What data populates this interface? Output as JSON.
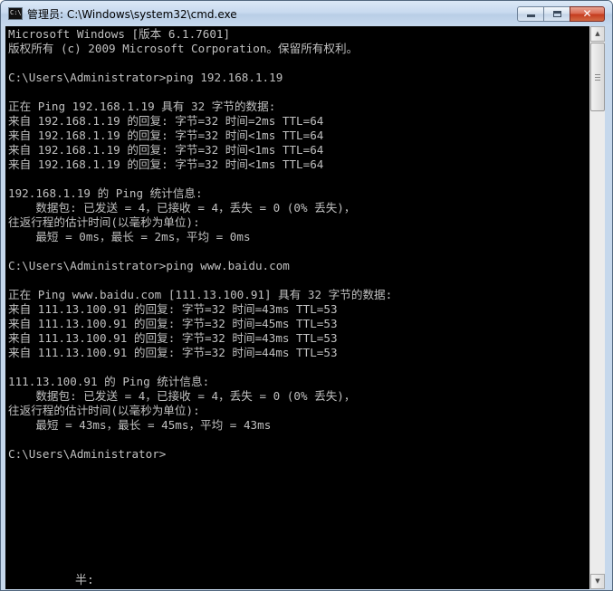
{
  "window": {
    "title": "管理员: C:\\Windows\\system32\\cmd.exe",
    "icon": "cmd-icon",
    "buttons": {
      "minimize": "minimize-icon",
      "maximize": "maximize-icon",
      "close": "✕"
    }
  },
  "console": {
    "lines": [
      "Microsoft Windows [版本 6.1.7601]",
      "版权所有 (c) 2009 Microsoft Corporation。保留所有权利。",
      "",
      "C:\\Users\\Administrator>ping 192.168.1.19",
      "",
      "正在 Ping 192.168.1.19 具有 32 字节的数据:",
      "来自 192.168.1.19 的回复: 字节=32 时间=2ms TTL=64",
      "来自 192.168.1.19 的回复: 字节=32 时间<1ms TTL=64",
      "来自 192.168.1.19 的回复: 字节=32 时间<1ms TTL=64",
      "来自 192.168.1.19 的回复: 字节=32 时间<1ms TTL=64",
      "",
      "192.168.1.19 的 Ping 统计信息:",
      "    数据包: 已发送 = 4，已接收 = 4，丢失 = 0 (0% 丢失)，",
      "往返行程的估计时间(以毫秒为单位):",
      "    最短 = 0ms，最长 = 2ms，平均 = 0ms",
      "",
      "C:\\Users\\Administrator>ping www.baidu.com",
      "",
      "正在 Ping www.baidu.com [111.13.100.91] 具有 32 字节的数据:",
      "来自 111.13.100.91 的回复: 字节=32 时间=43ms TTL=53",
      "来自 111.13.100.91 的回复: 字节=32 时间=45ms TTL=53",
      "来自 111.13.100.91 的回复: 字节=32 时间=43ms TTL=53",
      "来自 111.13.100.91 的回复: 字节=32 时间=44ms TTL=53",
      "",
      "111.13.100.91 的 Ping 统计信息:",
      "    数据包: 已发送 = 4，已接收 = 4，丢失 = 0 (0% 丢失)，",
      "往返行程的估计时间(以毫秒为单位):",
      "    最短 = 43ms，最长 = 45ms，平均 = 43ms",
      "",
      "C:\\Users\\Administrator>"
    ],
    "ime_indicator": "半:"
  },
  "scrollbar": {
    "up_icon": "arrow-up-icon",
    "down_icon": "arrow-down-icon"
  },
  "colors": {
    "console_background": "#000000",
    "console_text": "#c0c0c0",
    "titlebar": "#c8daef",
    "close_button": "#c4391c"
  }
}
